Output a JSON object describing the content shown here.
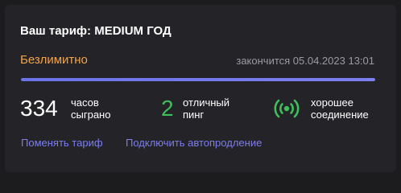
{
  "card": {
    "title": "Ваш тариф: MEDIUM ГОД",
    "tariff_name": "Безлимитно",
    "expires_text": "закончится 05.04.2023 13:01",
    "progress_fraction": 1.0
  },
  "stats": {
    "hours": {
      "value": "334",
      "label": "часов сыграно"
    },
    "ping": {
      "value": "2",
      "label": "отличный пинг"
    },
    "connection": {
      "icon": "signal-broadcast-icon",
      "label": "хорошее соединение"
    }
  },
  "links": {
    "change_tariff": "Поменять тариф",
    "enable_autorenew": "Подключить автопродление"
  },
  "colors": {
    "accent_orange": "#f2a34a",
    "accent_green": "#3fbf5b",
    "link_purple": "#7c7cf0",
    "progress": "#6a73ea"
  }
}
